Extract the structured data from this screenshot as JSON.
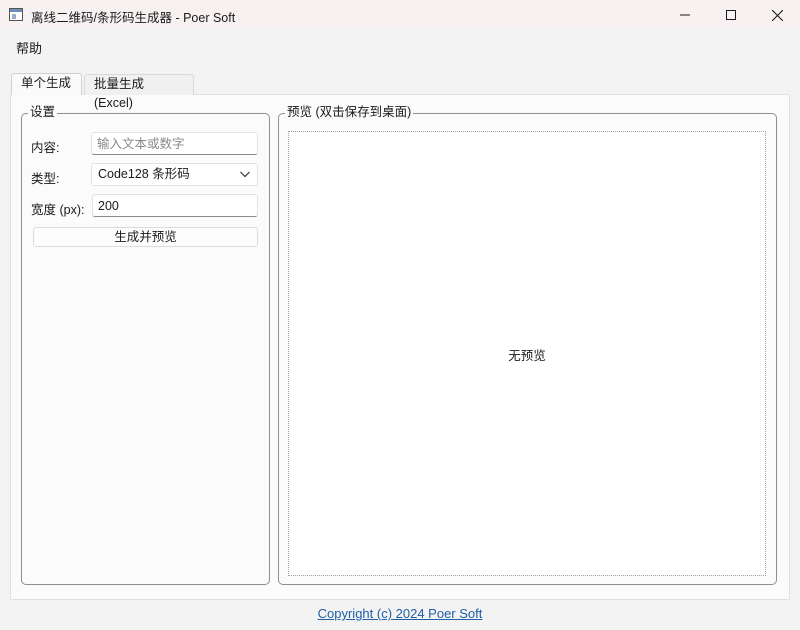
{
  "window": {
    "title": "离线二维码/条形码生成器 - Poer Soft",
    "icons": [
      "minimize-icon",
      "maximize-icon",
      "close-icon"
    ]
  },
  "menubar": {
    "items": [
      {
        "label": "帮助"
      }
    ]
  },
  "tabs": [
    {
      "label": "单个生成",
      "active": true
    },
    {
      "label": "批量生成 (Excel)",
      "active": false
    }
  ],
  "settings": {
    "group_title": "设置",
    "content_label": "内容:",
    "content_placeholder": "输入文本或数字",
    "content_value": "",
    "type_label": "类型:",
    "type_value": "Code128 条形码",
    "width_label": "宽度 (px):",
    "width_value": "200",
    "generate_button": "生成并预览"
  },
  "preview": {
    "group_title": "预览 (双击保存到桌面)",
    "empty_text": "无预览"
  },
  "footer": {
    "copyright": "Copyright (c) 2024 Poer Soft"
  },
  "colors": {
    "link": "#1f5fa8",
    "titlebar": "#f7f1f1",
    "background": "#f3f3f3"
  }
}
